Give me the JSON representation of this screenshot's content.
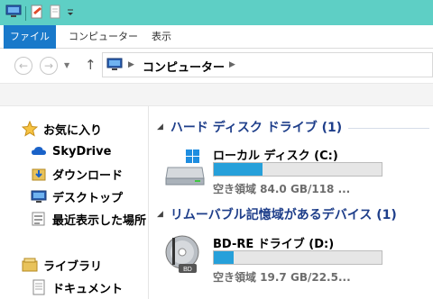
{
  "ribbon": {
    "tabs": [
      "ファイル",
      "コンピューター",
      "表示"
    ]
  },
  "address": {
    "location": "コンピューター"
  },
  "sidebar": {
    "items": [
      {
        "label": "お気に入り",
        "icon": "star-icon"
      },
      {
        "label": "SkyDrive",
        "icon": "cloud-icon"
      },
      {
        "label": "ダウンロード",
        "icon": "download-folder-icon"
      },
      {
        "label": "デスクトップ",
        "icon": "desktop-icon"
      },
      {
        "label": "最近表示した場所",
        "icon": "recent-places-icon"
      },
      {
        "label": "ライブラリ",
        "icon": "library-icon"
      },
      {
        "label": "ドキュメント",
        "icon": "document-icon"
      }
    ]
  },
  "content": {
    "groups": [
      {
        "title": "ハード ディスク ドライブ (1)"
      },
      {
        "title": "リムーバブル記憶域があるデバイス (1)"
      }
    ],
    "drives": [
      {
        "name": "ローカル ディスク (C:)",
        "free_label": "空き領域 84.0 GB/118 ...",
        "used_fraction": 0.29,
        "icon": "hard-disk-icon"
      },
      {
        "name": "BD-RE ドライブ (D:)",
        "free_label": "空き領域 19.7 GB/22.5...",
        "used_fraction": 0.12,
        "icon": "bd-disc-icon"
      }
    ]
  },
  "colors": {
    "title_bar": "#5ecfc5",
    "file_tab": "#1979ca",
    "progress": "#26a0da",
    "group_header": "#1e3e8a"
  }
}
